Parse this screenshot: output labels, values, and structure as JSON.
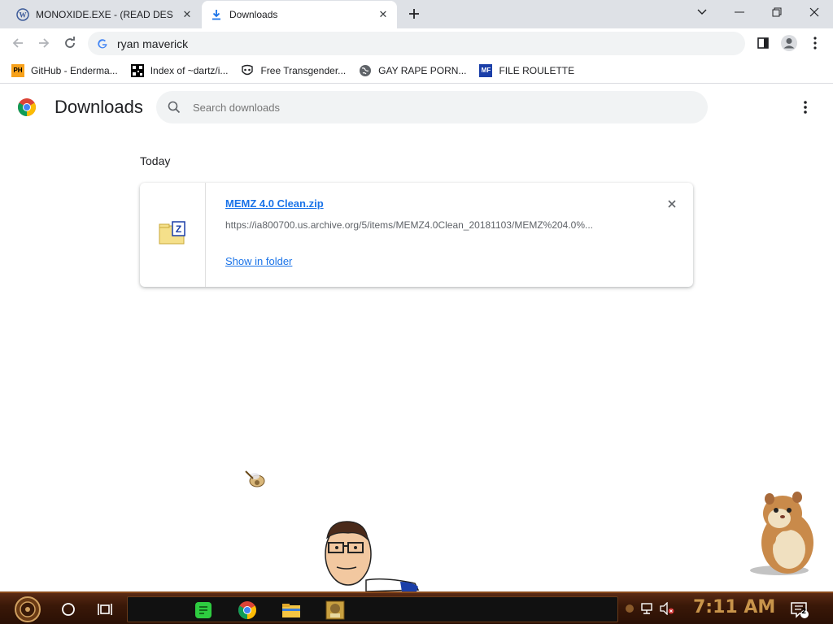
{
  "browser": {
    "tabs": [
      {
        "title": "MONOXIDE.EXE - (READ DES",
        "icon": "wordpress-icon",
        "active": false
      },
      {
        "title": "Downloads",
        "icon": "download-icon",
        "active": true
      }
    ],
    "omnibox": {
      "value": "ryan maverick",
      "icon": "google-icon"
    },
    "bookmarks": [
      {
        "label": "GitHub - Enderma...",
        "icon": "ph-icon",
        "icon_text": "PH"
      },
      {
        "label": "Index of ~dartz/i...",
        "icon": "qr-icon",
        "icon_text": ""
      },
      {
        "label": "Free Transgender...",
        "icon": "mask-icon",
        "icon_text": ""
      },
      {
        "label": "GAY RAPE PORN...",
        "icon": "globe-icon",
        "icon_text": ""
      },
      {
        "label": "FILE ROULETTE",
        "icon": "mf-icon",
        "icon_text": "MF"
      }
    ]
  },
  "downloads_page": {
    "title": "Downloads",
    "search_placeholder": "Search downloads",
    "section": "Today",
    "items": [
      {
        "file_name": "MEMZ 4.0 Clean.zip",
        "url": "https://ia800700.us.archive.org/5/items/MEMZ4.0Clean_20181103/MEMZ%204.0%...",
        "action": "Show in folder",
        "icon": "zip-folder-icon"
      }
    ]
  },
  "taskbar": {
    "clock": "7:11 AM",
    "notification_count": "2",
    "pinned_apps": [
      "notes-app-icon",
      "chrome-icon",
      "file-explorer-icon",
      "box-app-icon"
    ]
  },
  "colors": {
    "link": "#1a73e8",
    "tab_strip": "#dee1e6",
    "clock": "#c8944a",
    "taskbar": "#3a1808"
  }
}
